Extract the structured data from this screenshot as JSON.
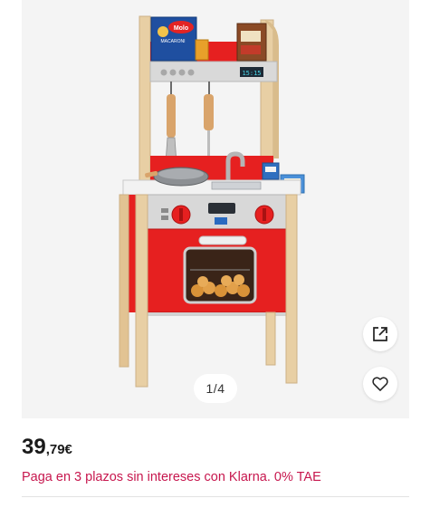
{
  "gallery": {
    "pager_text": "1/4",
    "share_icon": "share-external-icon",
    "favorite_icon": "heart-icon",
    "image": {
      "packages": [
        "Molo",
        "MACARONI"
      ],
      "clock_text": "15:15"
    }
  },
  "price": {
    "integer": "39",
    "decimal": ",79€"
  },
  "financing": {
    "text": "Paga en 3 plazos sin intereses con Klarna. 0% TAE"
  },
  "colors": {
    "accent": "#c7174e",
    "kitchen_red": "#e62020",
    "wood": "#e8cfa4"
  }
}
